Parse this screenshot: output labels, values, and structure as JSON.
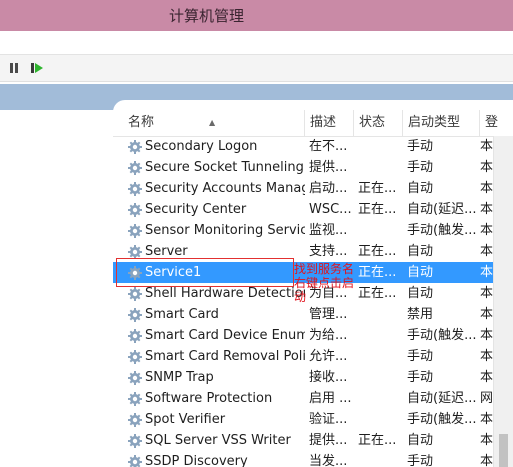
{
  "window": {
    "title": "计算机管理"
  },
  "toolbar": {
    "pause_icon": "pause-icon",
    "restart_icon": "restart-icon"
  },
  "table": {
    "columns": [
      "名称",
      "描述",
      "状态",
      "启动类型",
      "登"
    ],
    "rows": [
      {
        "name": "Secondary Logon",
        "desc": "在不...",
        "status": "",
        "startup": "手动",
        "logon": "本"
      },
      {
        "name": "Secure Socket Tunneling ...",
        "desc": "提供...",
        "status": "",
        "startup": "手动",
        "logon": "本"
      },
      {
        "name": "Security Accounts Manag...",
        "desc": "启动...",
        "status": "正在...",
        "startup": "自动",
        "logon": "本"
      },
      {
        "name": "Security Center",
        "desc": "WSC...",
        "status": "正在...",
        "startup": "自动(延迟...",
        "logon": "本"
      },
      {
        "name": "Sensor Monitoring Service",
        "desc": "监视...",
        "status": "",
        "startup": "手动(触发...",
        "logon": "本"
      },
      {
        "name": "Server",
        "desc": "支持...",
        "status": "正在...",
        "startup": "自动",
        "logon": "本"
      },
      {
        "name": "Service1",
        "desc": "",
        "status": "正在...",
        "startup": "自动",
        "logon": "本"
      },
      {
        "name": "Shell Hardware Detection",
        "desc": "为自...",
        "status": "正在...",
        "startup": "自动",
        "logon": "本"
      },
      {
        "name": "Smart Card",
        "desc": "管理...",
        "status": "",
        "startup": "禁用",
        "logon": "本"
      },
      {
        "name": "Smart Card Device Enum...",
        "desc": "为给...",
        "status": "",
        "startup": "手动(触发...",
        "logon": "本"
      },
      {
        "name": "Smart Card Removal Poli...",
        "desc": "允许...",
        "status": "",
        "startup": "手动",
        "logon": "本"
      },
      {
        "name": "SNMP Trap",
        "desc": "接收...",
        "status": "",
        "startup": "手动",
        "logon": "本"
      },
      {
        "name": "Software Protection",
        "desc": "启用 ...",
        "status": "",
        "startup": "自动(延迟...",
        "logon": "网"
      },
      {
        "name": "Spot Verifier",
        "desc": "验证...",
        "status": "",
        "startup": "手动(触发...",
        "logon": "本"
      },
      {
        "name": "SQL Server VSS Writer",
        "desc": "提供...",
        "status": "正在...",
        "startup": "自动",
        "logon": "本"
      },
      {
        "name": "SSDP Discovery",
        "desc": "当发...",
        "status": "",
        "startup": "手动",
        "logon": "本"
      }
    ],
    "selected_index": 6
  },
  "annotation": {
    "text": "找到服务名右键点击启动"
  },
  "colors": {
    "title_bar": "#c98aa6",
    "selection": "#3399ff",
    "annotation": "#e0141e",
    "pane_blue": "#a2bcd9"
  }
}
